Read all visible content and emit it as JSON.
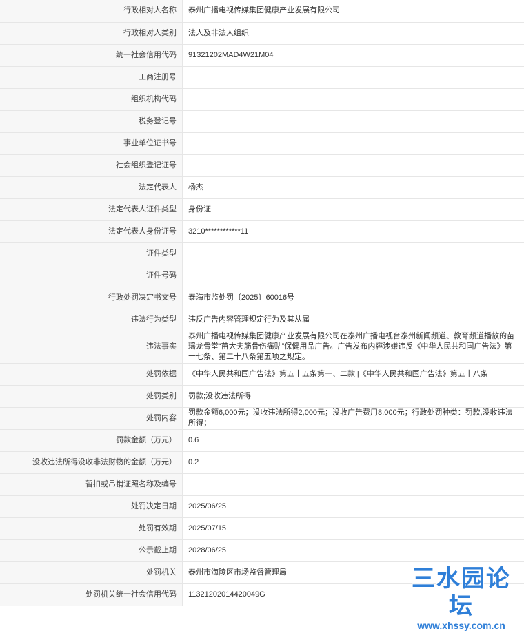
{
  "rows": [
    {
      "label": "行政相对人名称",
      "value": "泰州广播电视传媒集团健康产业发展有限公司"
    },
    {
      "label": "行政相对人类别",
      "value": "法人及非法人组织"
    },
    {
      "label": "统一社会信用代码",
      "value": "91321202MAD4W21M04"
    },
    {
      "label": "工商注册号",
      "value": ""
    },
    {
      "label": "组织机构代码",
      "value": ""
    },
    {
      "label": "税务登记号",
      "value": ""
    },
    {
      "label": "事业单位证书号",
      "value": ""
    },
    {
      "label": "社会组织登记证号",
      "value": ""
    },
    {
      "label": "法定代表人",
      "value": "杨杰"
    },
    {
      "label": "法定代表人证件类型",
      "value": "身份证"
    },
    {
      "label": "法定代表人身份证号",
      "value": "3210************11"
    },
    {
      "label": "证件类型",
      "value": ""
    },
    {
      "label": "证件号码",
      "value": ""
    },
    {
      "label": "行政处罚决定书文号",
      "value": "泰海市监处罚〔2025〕60016号"
    },
    {
      "label": "违法行为类型",
      "value": "违反广告内容管理规定行为及其从属"
    },
    {
      "label": "违法事实",
      "value": "泰州广播电视传媒集团健康产业发展有限公司在泰州广播电视台泰州新闻频道、教育频道播放的苗瑶龙骨堂“苗大夫筋骨伤痛贴”保健用品广告。广告发布内容涉嫌违反《中华人民共和国广告法》第十七条、第二十八条第五项之规定。"
    },
    {
      "label": "处罚依据",
      "value": "《中华人民共和国广告法》第五十五条第一、二款||《中华人民共和国广告法》第五十八条"
    },
    {
      "label": "处罚类别",
      "value": "罚款;没收违法所得"
    },
    {
      "label": "处罚内容",
      "value": "罚款金额6,000元；没收违法所得2,000元；没收广告费用8,000元；行政处罚种类：罚款,没收违法所得；"
    },
    {
      "label": "罚款金额（万元）",
      "value": "0.6"
    },
    {
      "label": "没收违法所得没收非法财物的金额（万元）",
      "value": "0.2"
    },
    {
      "label": "暂扣或吊销证照名称及编号",
      "value": ""
    },
    {
      "label": "处罚决定日期",
      "value": "2025/06/25"
    },
    {
      "label": "处罚有效期",
      "value": "2025/07/15"
    },
    {
      "label": "公示截止期",
      "value": "2028/06/25"
    },
    {
      "label": "处罚机关",
      "value": "泰州市海陵区市场监督管理局"
    },
    {
      "label": "处罚机关统一社会信用代码",
      "value": "11321202014420049G"
    }
  ],
  "watermark": {
    "title": "三水园论坛",
    "url": "www.xhssy.com.cn"
  }
}
